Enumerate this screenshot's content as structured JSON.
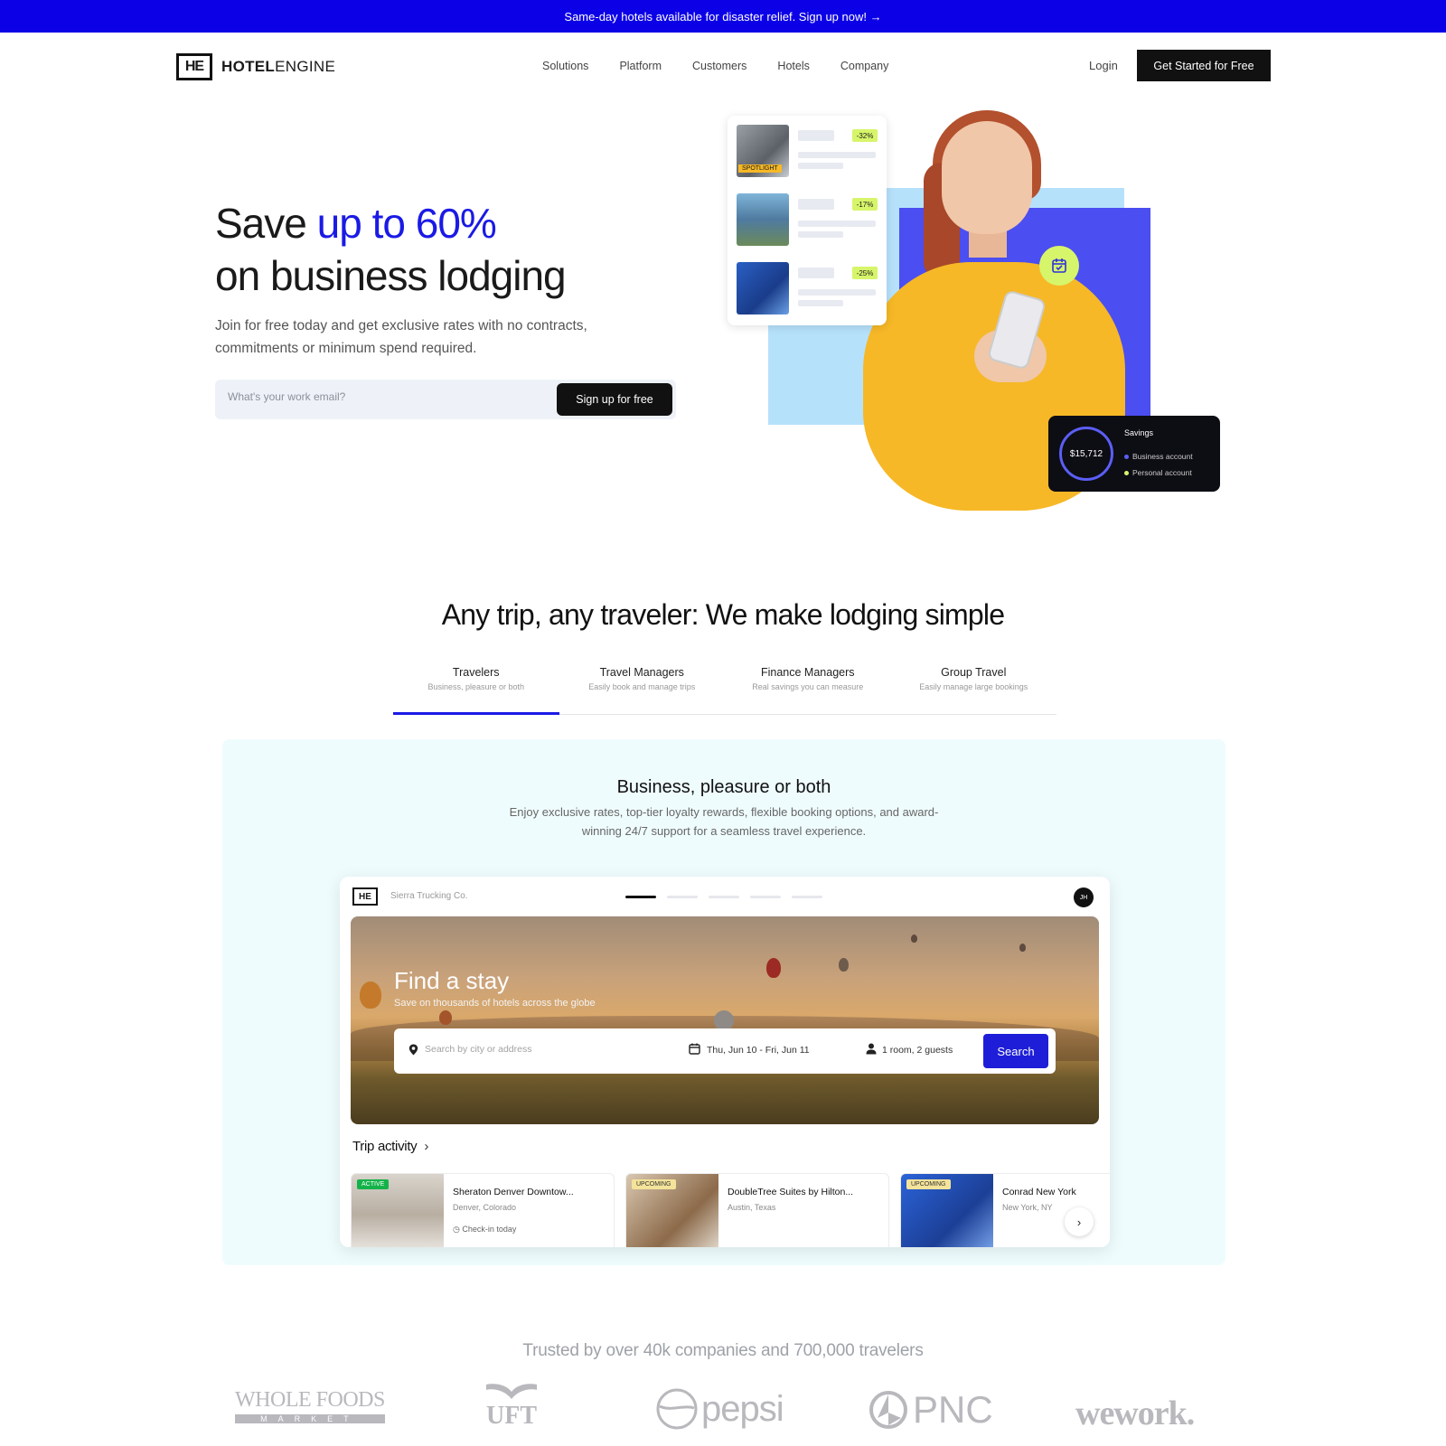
{
  "banner": {
    "text": "Same-day hotels available for disaster relief. Sign up now! →"
  },
  "nav": {
    "logo_mark": "HE",
    "logo_bold": "HOTEL",
    "logo_light": "ENGINE",
    "links": [
      "Solutions",
      "Platform",
      "Customers",
      "Hotels",
      "Company"
    ],
    "login": "Login",
    "cta": "Get Started for Free"
  },
  "hero": {
    "title_plain": "Save ",
    "title_accent": "up to 60%",
    "title_line2": "on business lodging",
    "subtitle": "Join for free today and get exclusive rates with no contracts, commitments or minimum spend required.",
    "email_placeholder": "What's your work email?",
    "signup_button": "Sign up for free",
    "hotel_card": {
      "spotlight_tag": "SPOTLIGHT",
      "discounts": [
        "-32%",
        "-17%",
        "-25%"
      ]
    },
    "savings_widget": {
      "amount": "$15,712",
      "title": "Savings",
      "legend": [
        "Business account",
        "Personal account"
      ]
    }
  },
  "section": {
    "title": "Any trip, any traveler: We make lodging simple",
    "tabs": [
      {
        "title": "Travelers",
        "sub": "Business, pleasure or both",
        "active": true
      },
      {
        "title": "Travel Managers",
        "sub": "Easily book and manage trips",
        "active": false
      },
      {
        "title": "Finance Managers",
        "sub": "Real savings you can measure",
        "active": false
      },
      {
        "title": "Group Travel",
        "sub": "Easily manage large bookings",
        "active": false
      }
    ],
    "panel_title": "Business, pleasure or both",
    "panel_desc": "Enjoy exclusive rates, top-tier loyalty rewards, flexible booking options, and award-winning 24/7 support for a seamless travel experience."
  },
  "app": {
    "logo_mark": "HE",
    "company": "Sierra Trucking Co.",
    "avatar": "JH",
    "find_title": "Find a stay",
    "find_sub": "Save on thousands of hotels across the globe",
    "search_placeholder": "Search by city or address",
    "dates": "Thu, Jun 10 - Fri, Jun 11",
    "guests": "1 room, 2 guests",
    "search_button": "Search",
    "trip_activity": "Trip activity",
    "trips": [
      {
        "tag": "ACTIVE",
        "name": "Sheraton Denver Downtow...",
        "location": "Denver, Colorado",
        "note": "Check-in today"
      },
      {
        "tag": "UPCOMING",
        "name": "DoubleTree Suites by Hilton...",
        "location": "Austin, Texas",
        "note": ""
      },
      {
        "tag": "UPCOMING",
        "name": "Conrad New York",
        "location": "New York, NY",
        "note": ""
      }
    ]
  },
  "trusted": {
    "text": "Trusted by over 40k companies and 700,000 travelers",
    "logos": [
      "WHOLE FOODS",
      "MARKET",
      "UFT",
      "pepsi",
      "PNC",
      "wework."
    ]
  },
  "colors": {
    "brand_blue": "#0c00e6",
    "accent_blue": "#1a1ae6",
    "lime": "#d7f56a",
    "yellow": "#f6b826"
  }
}
